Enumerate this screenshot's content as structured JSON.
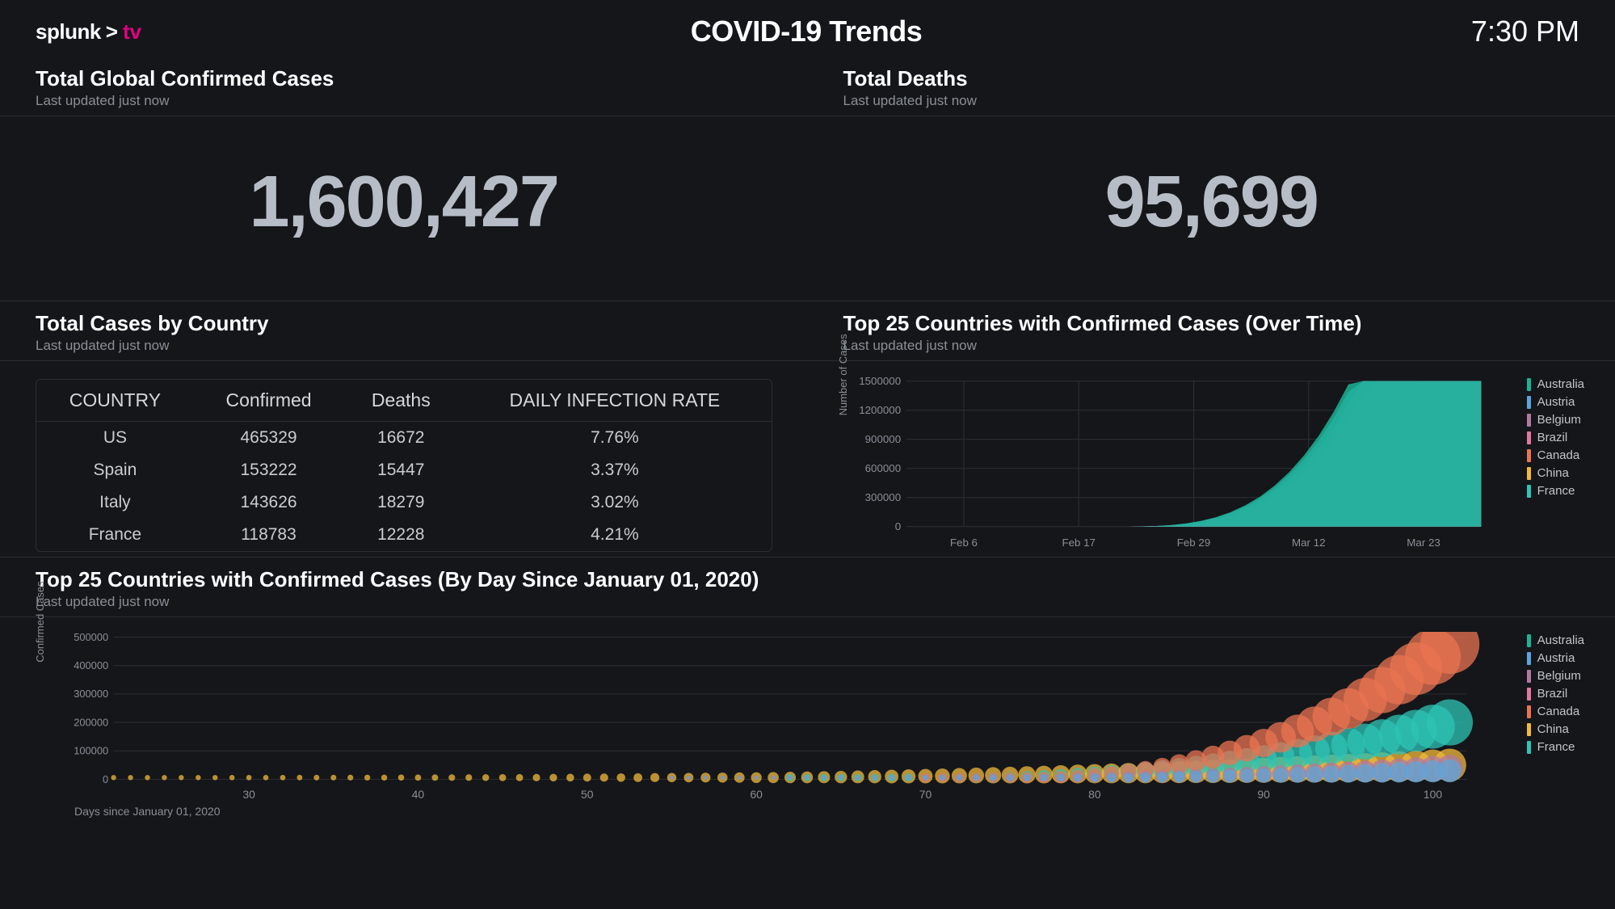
{
  "brand": {
    "name": "splunk",
    "gt": ">",
    "suffix": "tv"
  },
  "page_title": "COVID-19 Trends",
  "clock": "7:30 PM",
  "panels": {
    "confirmed": {
      "title": "Total Global Confirmed Cases",
      "updated": "Last updated just now",
      "value": "1,600,427"
    },
    "deaths": {
      "title": "Total Deaths",
      "updated": "Last updated just now",
      "value": "95,699"
    },
    "by_country": {
      "title": "Total Cases by Country",
      "updated": "Last updated just now"
    },
    "over_time": {
      "title": "Top 25 Countries with Confirmed Cases (Over Time)",
      "updated": "Last updated just now"
    },
    "by_day": {
      "title": "Top 25 Countries with Confirmed Cases (By Day Since January 01, 2020)",
      "updated": "Last updated just now"
    }
  },
  "table": {
    "columns": [
      "COUNTRY",
      "Confirmed",
      "Deaths",
      "DAILY INFECTION RATE"
    ],
    "rows": [
      {
        "country": "US",
        "confirmed": "465329",
        "deaths": "16672",
        "rate": "7.76%"
      },
      {
        "country": "Spain",
        "confirmed": "153222",
        "deaths": "15447",
        "rate": "3.37%"
      },
      {
        "country": "Italy",
        "confirmed": "143626",
        "deaths": "18279",
        "rate": "3.02%"
      },
      {
        "country": "France",
        "confirmed": "118783",
        "deaths": "12228",
        "rate": "4.21%"
      }
    ]
  },
  "chart_data": [
    {
      "id": "over_time",
      "type": "area",
      "title": "Top 25 Countries with Confirmed Cases (Over Time)",
      "ylabel": "Number of Cases",
      "ylim": [
        0,
        1500000
      ],
      "yticks": [
        0,
        300000,
        600000,
        900000,
        1200000,
        1500000
      ],
      "xticks": [
        "Feb 6",
        "Feb 17",
        "Feb 29",
        "Mar 12",
        "Mar 23"
      ],
      "legend": [
        {
          "name": "Australia",
          "color": "#1ab394"
        },
        {
          "name": "Austria",
          "color": "#5da5da"
        },
        {
          "name": "Belgium",
          "color": "#b07aa1"
        },
        {
          "name": "Brazil",
          "color": "#e377a0"
        },
        {
          "name": "Canada",
          "color": "#e97451"
        },
        {
          "name": "China",
          "color": "#f2b93b"
        },
        {
          "name": "France",
          "color": "#2ec4b6"
        }
      ]
    },
    {
      "id": "by_day",
      "type": "scatter",
      "title": "Top 25 Countries with Confirmed Cases (By Day Since January 01, 2020)",
      "xlabel": "Days since January 01, 2020",
      "ylabel": "Confirmed Cases",
      "ylim": [
        0,
        500000
      ],
      "yticks": [
        0,
        100000,
        200000,
        300000,
        400000,
        500000
      ],
      "xticks": [
        30,
        40,
        50,
        60,
        70,
        80,
        90,
        100
      ],
      "legend": [
        {
          "name": "Australia",
          "color": "#1ab394"
        },
        {
          "name": "Austria",
          "color": "#5da5da"
        },
        {
          "name": "Belgium",
          "color": "#b07aa1"
        },
        {
          "name": "Brazil",
          "color": "#e377a0"
        },
        {
          "name": "Canada",
          "color": "#e97451"
        },
        {
          "name": "China",
          "color": "#f2b93b"
        },
        {
          "name": "France",
          "color": "#2ec4b6"
        }
      ]
    }
  ]
}
